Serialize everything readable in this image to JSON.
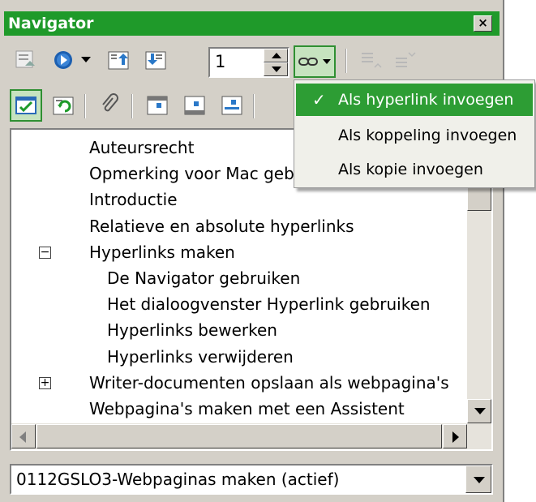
{
  "window": {
    "title": "Navigator",
    "close_label": "×"
  },
  "toolbar": {
    "page_number": "1",
    "icons": [
      "headings-icon",
      "navigation-icon",
      "previous-icon",
      "next-icon",
      "page-icon",
      "drag-mode-icon",
      "promote-level-icon",
      "demote-level-icon",
      "content-view-icon",
      "update-icon",
      "reminder-icon",
      "header-icon",
      "footer-icon",
      "anchor-icon"
    ]
  },
  "drag_menu": {
    "items": [
      {
        "label": "Als hyperlink invoegen",
        "checked": true
      },
      {
        "label": "Als koppeling invoegen",
        "checked": false
      },
      {
        "label": "Als kopie invoegen",
        "checked": false
      }
    ],
    "check_mark": "✓"
  },
  "tree": {
    "items": [
      {
        "label": "Auteursrecht",
        "level": 0
      },
      {
        "label": "Opmerking voor Mac  geb",
        "level": 0
      },
      {
        "label": "Introductie",
        "level": 0
      },
      {
        "label": "Relatieve en absolute hyperlinks",
        "level": 0
      },
      {
        "label": "Hyperlinks maken",
        "level": 0,
        "expander": "−"
      },
      {
        "label": "De Navigator gebruiken",
        "level": 1
      },
      {
        "label": "Het dialoogvenster Hyperlink gebruiken",
        "level": 1
      },
      {
        "label": "Hyperlinks bewerken",
        "level": 1
      },
      {
        "label": "Hyperlinks verwijderen",
        "level": 1
      },
      {
        "label": "Writer-documenten opslaan als webpagina's",
        "level": 0,
        "expander": "+"
      },
      {
        "label": "Webpagina's maken met een Assistent",
        "level": 0
      }
    ]
  },
  "document_select": {
    "value": "0112GSLO3-Webpaginas maken (actief)"
  },
  "colors": {
    "accent": "#1f9a2a",
    "menu_highlight": "#2d9d34",
    "panel": "#d4d0c8"
  }
}
